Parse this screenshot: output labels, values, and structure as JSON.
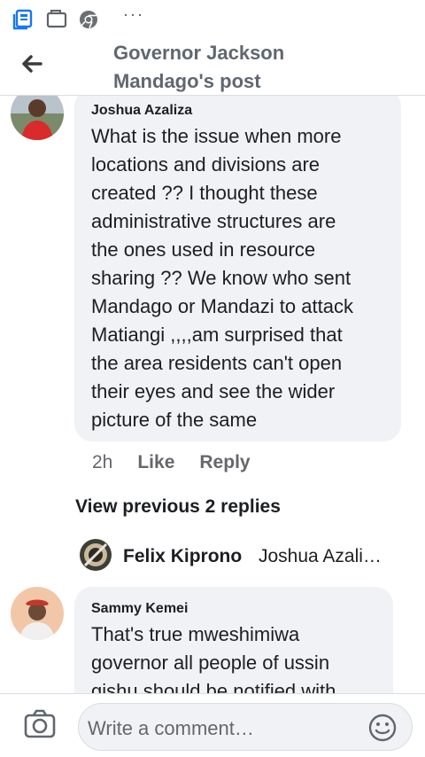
{
  "statusbar": {
    "icons": [
      "news-app-icon",
      "wallet-icon",
      "chrome-icon"
    ],
    "more": "···"
  },
  "header": {
    "title_line1": "Governor Jackson",
    "title_line2": "Mandago's post"
  },
  "comments": [
    {
      "author": "Joshua Azaliza",
      "lines": [
        "What is the issue when more",
        "locations and divisions are",
        "created ?? I thought these",
        "administrative structures are",
        "the ones used in resource",
        "sharing ?? We know who sent",
        "Mandago or Mandazi to attack",
        "Matiangi ,,,,am surprised that",
        "the area residents can't open",
        "their eyes and see the wider",
        "picture of the same"
      ],
      "time": "2h",
      "like_label": "Like",
      "reply_label": "Reply"
    },
    {
      "author": "Sammy Kemei",
      "lines": [
        "That's true mweshimiwa",
        "governor all people of ussin",
        "gishu should be notified with"
      ]
    }
  ],
  "view_previous": "View previous 2 replies",
  "reply_preview": {
    "author": "Felix Kiprono",
    "text": "Joshua Azali…"
  },
  "composer": {
    "placeholder": "Write a comment…"
  },
  "colors": {
    "bubble": "#f0f2f5",
    "muted": "#65676b",
    "accent": "#1877f2"
  }
}
